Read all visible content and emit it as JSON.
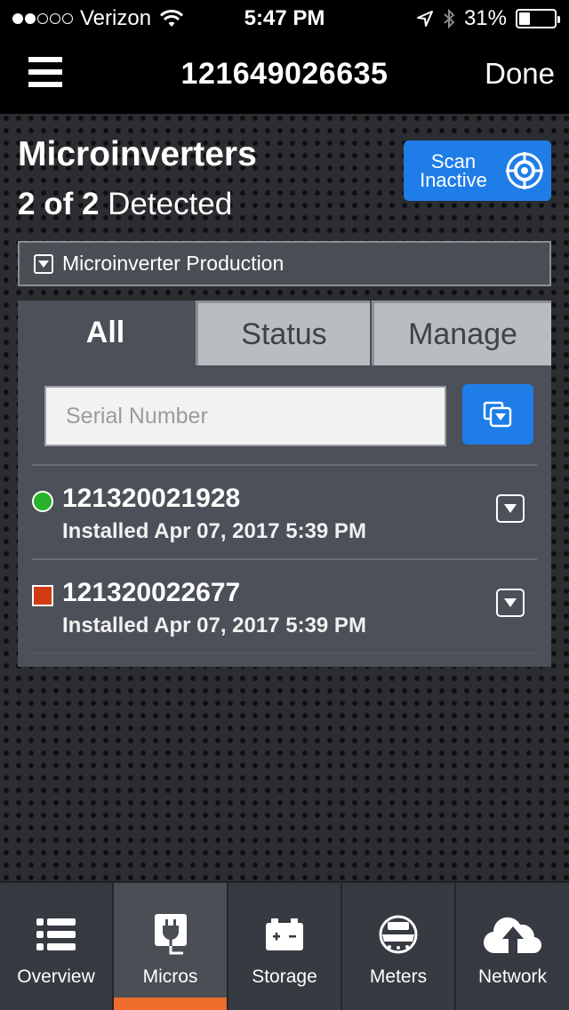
{
  "status_bar": {
    "carrier": "Verizon",
    "time": "5:47 PM",
    "battery": "31%",
    "battery_level": 0.31,
    "signal_dots_filled": 2,
    "signal_dots_total": 5
  },
  "nav": {
    "title": "121649026635",
    "done_label": "Done"
  },
  "header": {
    "title": "Microinverters",
    "detected_count": "2 of 2",
    "detected_label": "Detected",
    "scan_button": {
      "line1": "Scan",
      "line2": "Inactive"
    }
  },
  "production_bar": {
    "label": "Microinverter Production"
  },
  "tabs": [
    {
      "label": "All",
      "active": true
    },
    {
      "label": "Status",
      "active": false
    },
    {
      "label": "Manage",
      "active": false
    }
  ],
  "search": {
    "placeholder": "Serial Number",
    "value": ""
  },
  "devices": [
    {
      "serial": "121320021928",
      "installed": "Installed Apr 07, 2017 5:39 PM",
      "status": "ok",
      "status_color": "#27b32a"
    },
    {
      "serial": "121320022677",
      "installed": "Installed Apr 07, 2017 5:39 PM",
      "status": "error",
      "status_color": "#d23a12"
    }
  ],
  "bottom_tabs": [
    {
      "label": "Overview",
      "icon": "list-icon",
      "active": false
    },
    {
      "label": "Micros",
      "icon": "plug-icon",
      "active": true
    },
    {
      "label": "Storage",
      "icon": "battery-icon",
      "active": false
    },
    {
      "label": "Meters",
      "icon": "meter-icon",
      "active": false
    },
    {
      "label": "Network",
      "icon": "cloud-upload-icon",
      "active": false
    }
  ],
  "colors": {
    "accent_blue": "#1f7de8",
    "active_tab_indicator": "#ee6c2c"
  }
}
